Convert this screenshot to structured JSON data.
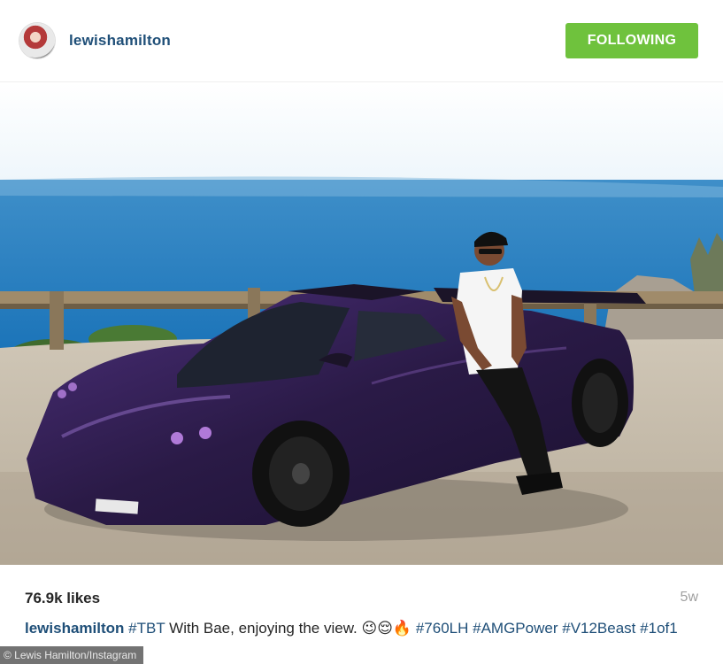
{
  "post": {
    "username": "lewishamilton",
    "follow_label": "FOLLOWING",
    "likes": "76.9k likes",
    "timestamp": "5w",
    "caption": {
      "user": "lewishamilton",
      "tag1": "#TBT",
      "text": " With Bae, enjoying the view. 😉😌🔥 ",
      "tag2": "#760LH",
      "tag3": "#AMGPower",
      "tag4": "#V12Beast",
      "tag5": "#1of1"
    }
  },
  "photo": {
    "subject": "purple supercar on a cliff overlooking the sea, man leaning on car",
    "plate_text": "—"
  },
  "credit": "© Lewis Hamilton/Instagram",
  "colors": {
    "follow_button": "#6fc23d",
    "username": "#1f4f78",
    "hashtag": "#1f4f78"
  }
}
